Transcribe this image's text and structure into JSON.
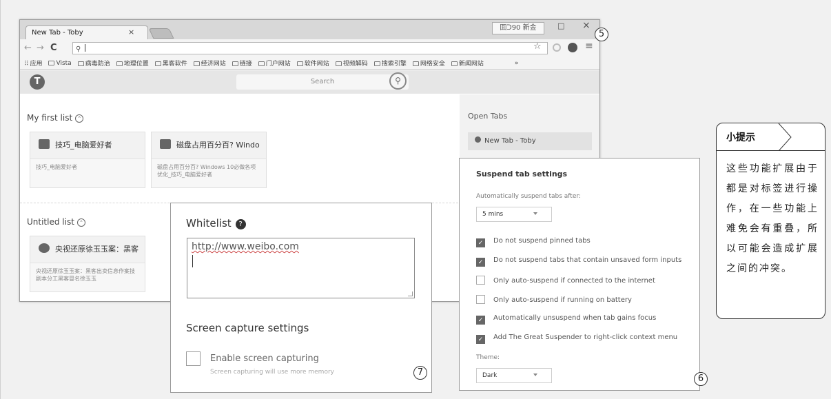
{
  "browser": {
    "tab_title": "New Tab - Toby",
    "tab_close": "×",
    "window_stamp": "囬ᑐ90 新金",
    "window_min": "□",
    "window_close": "×",
    "nav_back": "←",
    "nav_forward": "→",
    "nav_reload": "C",
    "omnibox_icon": "⚲",
    "star": "☆",
    "menu": "≡",
    "bookmarks": [
      "应用",
      "Vista",
      "病毒防治",
      "地理位置",
      "黑客软件",
      "经济网站",
      "链接",
      "门户网站",
      "软件网站",
      "视频解码",
      "搜索引擎",
      "网络安全",
      "新闻网站"
    ],
    "bookmarks_more": "»"
  },
  "app": {
    "logo": "T",
    "search_placeholder": "Search",
    "list1_title": "My first list",
    "list1_cards": [
      {
        "title": "技巧_电脑爱好者",
        "desc": "技巧_电脑爱好者"
      },
      {
        "title": "磁盘占用百分百? Windo",
        "desc": "磁盘占用百分百? Windows 10必做各项优化_技巧_电脑爱好者"
      }
    ],
    "list2_title": "Untitled list",
    "list2_cards": [
      {
        "title": "央视还原徐玉玉案：黑客",
        "desc": "央视还原徐玉玉案：黑客出卖信息作案技剧本分工黑客冒名徐玉玉"
      }
    ],
    "open_tabs_title": "Open Tabs",
    "open_tabs": [
      "New Tab - Toby"
    ]
  },
  "whitelist": {
    "title": "Whitelist",
    "help": "?",
    "value": "http://www.weibo.com",
    "screen_title": "Screen capture settings",
    "enable_label": "Enable screen capturing",
    "enable_sub": "Screen capturing will use more memory"
  },
  "suspend": {
    "title": "Suspend tab settings",
    "after_label": "Automatically suspend tabs after:",
    "after_value": "5 mins",
    "options": [
      {
        "label": "Do not suspend pinned tabs",
        "checked": true
      },
      {
        "label": "Do not suspend tabs that contain unsaved form inputs",
        "checked": true
      },
      {
        "label": "Only auto-suspend if connected to the internet",
        "checked": false
      },
      {
        "label": "Only auto-suspend if running on battery",
        "checked": false
      },
      {
        "label": "Automatically unsuspend when tab gains focus",
        "checked": true
      },
      {
        "label": "Add The Great Suspender to right-click context menu",
        "checked": true
      }
    ],
    "theme_label": "Theme:",
    "theme_value": "Dark"
  },
  "callouts": {
    "five": "5",
    "six": "6",
    "seven": "7"
  },
  "tip": {
    "title": "小提示",
    "body": "这些功能扩展由于都是对标签进行操作，在一些功能上难免会有重叠，所以可能会造成扩展之间的冲突。"
  }
}
